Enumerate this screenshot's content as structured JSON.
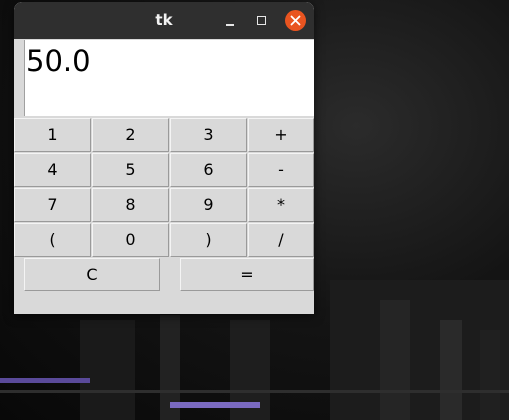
{
  "window": {
    "title": "tk",
    "controls": [
      "minimize-icon",
      "maximize-icon",
      "close-icon"
    ]
  },
  "display": {
    "value": "50.0"
  },
  "keypad": {
    "rows": [
      [
        "1",
        "2",
        "3",
        "+"
      ],
      [
        "4",
        "5",
        "6",
        "-"
      ],
      [
        "7",
        "8",
        "9",
        "*"
      ],
      [
        "(",
        "0",
        ")",
        "/"
      ]
    ],
    "clear_label": "C",
    "equals_label": "="
  },
  "colors": {
    "titlebar": "#2f2f2f",
    "close_button": "#e95420",
    "window_bg": "#d9d9d9",
    "display_bg": "#ffffff"
  }
}
